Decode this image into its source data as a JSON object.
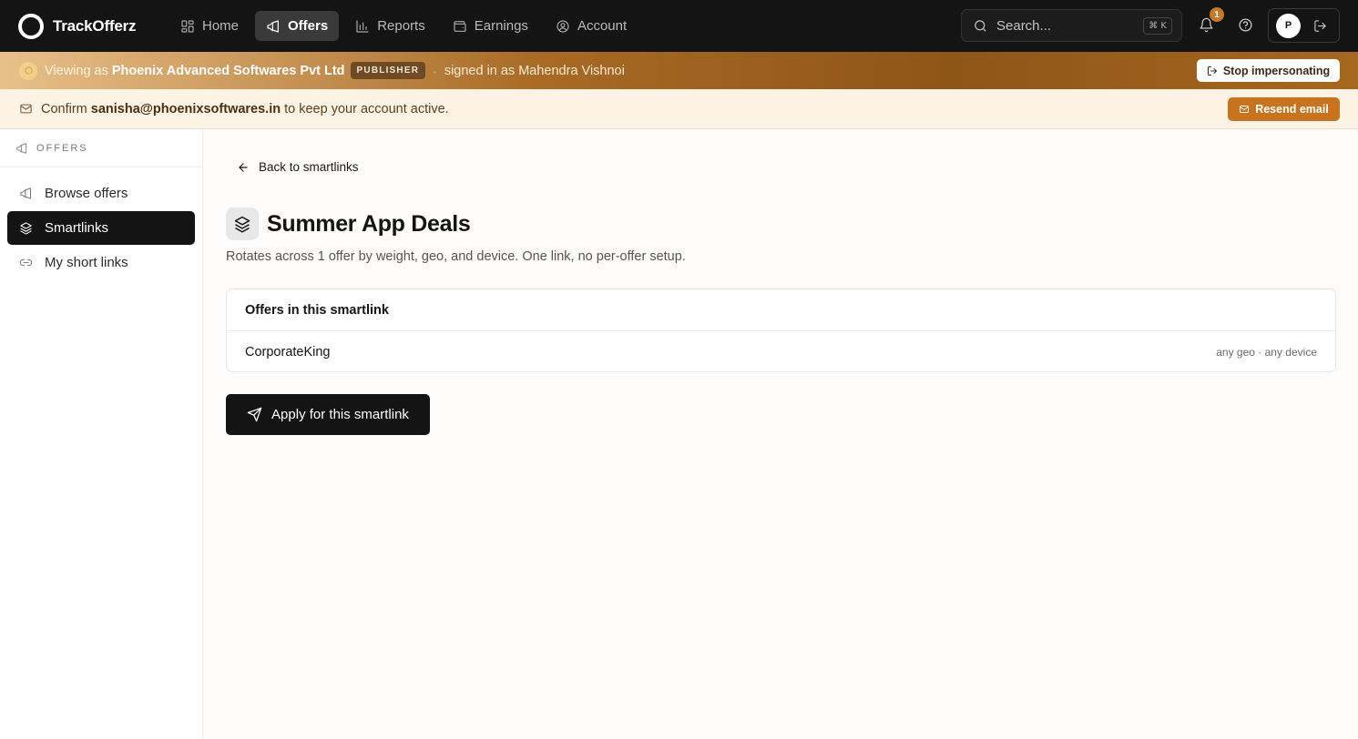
{
  "brand": {
    "name": "TrackOfferz"
  },
  "nav": {
    "items": [
      {
        "label": "Home",
        "icon": "grid-icon",
        "active": false
      },
      {
        "label": "Offers",
        "icon": "megaphone-icon",
        "active": true
      },
      {
        "label": "Reports",
        "icon": "bar-chart-icon",
        "active": false
      },
      {
        "label": "Earnings",
        "icon": "wallet-icon",
        "active": false
      },
      {
        "label": "Account",
        "icon": "user-circle-icon",
        "active": false
      }
    ]
  },
  "search": {
    "placeholder": "Search...",
    "shortcut": "⌘ K"
  },
  "notifications": {
    "count": "1"
  },
  "user": {
    "initial": "P"
  },
  "impersonation": {
    "prefix": "Viewing as",
    "org": "Phoenix Advanced Softwares Pvt Ltd",
    "role": "PUBLISHER",
    "separator": "·",
    "signed_in": "signed in as Mahendra Vishnoi",
    "stop_label": "Stop impersonating"
  },
  "confirm": {
    "prefix": "Confirm",
    "email": "sanisha@phoenixsoftwares.in",
    "suffix": "to keep your account active.",
    "resend_label": "Resend email"
  },
  "sidebar": {
    "heading": "OFFERS",
    "items": [
      {
        "label": "Browse offers",
        "icon": "megaphone-icon",
        "active": false
      },
      {
        "label": "Smartlinks",
        "icon": "layers-icon",
        "active": true
      },
      {
        "label": "My short links",
        "icon": "link-icon",
        "active": false
      }
    ]
  },
  "main": {
    "back_label": "Back to smartlinks",
    "title": "Summer App Deals",
    "subtitle": "Rotates across 1 offer by weight, geo, and device. One link, no per-offer setup.",
    "card": {
      "heading": "Offers in this smartlink",
      "rows": [
        {
          "name": "CorporateKing",
          "meta": "any geo · any device"
        }
      ]
    },
    "apply_label": "Apply for this smartlink"
  },
  "colors": {
    "topbar": "#141414",
    "accent": "#c8741e",
    "confirm_bg": "#fdf3e4"
  }
}
